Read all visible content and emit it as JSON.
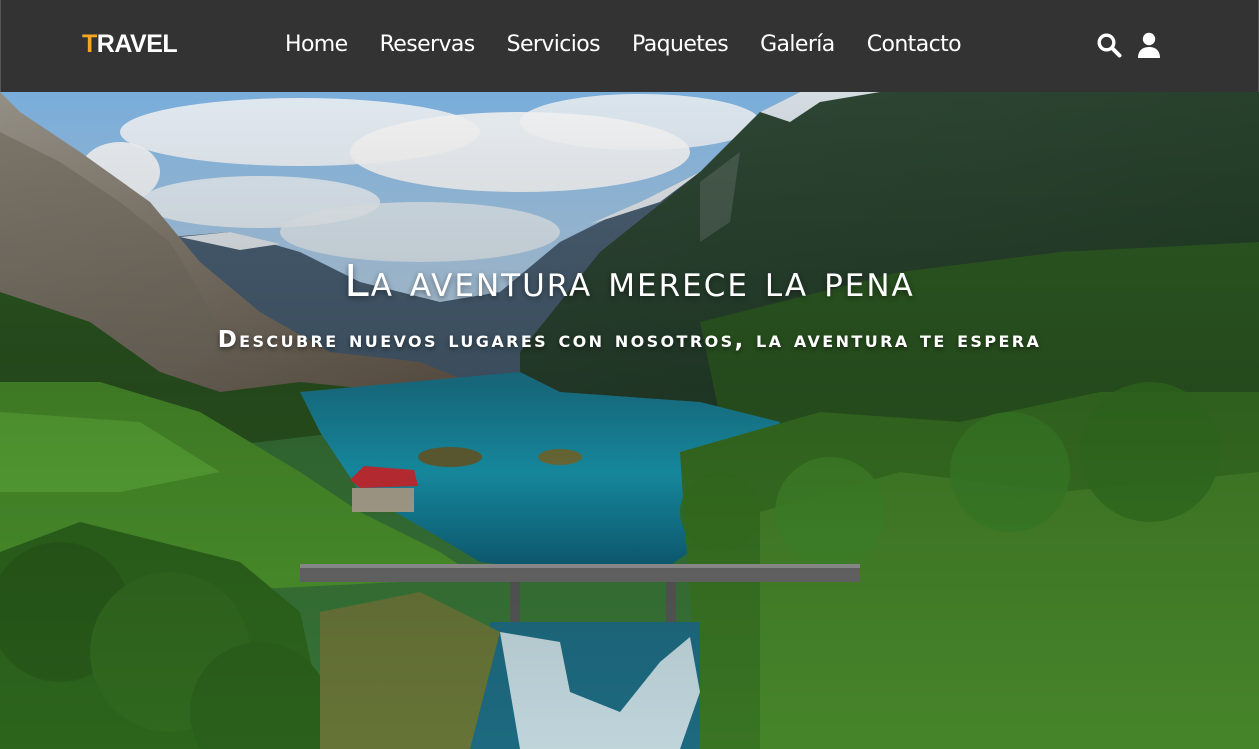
{
  "header": {
    "logo": {
      "accent_letter": "T",
      "rest": "RAVEL"
    },
    "nav": [
      "Home",
      "Reservas",
      "Servicios",
      "Paquetes",
      "Galería",
      "Contacto"
    ],
    "icons": [
      "search-icon",
      "user-icon"
    ]
  },
  "hero": {
    "title": "La aventura merece la pena",
    "subtitle": "Descubre nuevos lugares con nosotros, la aventura te espera"
  },
  "colors": {
    "header_bg": "#333333",
    "accent": "#f6a623",
    "text": "#ffffff"
  }
}
